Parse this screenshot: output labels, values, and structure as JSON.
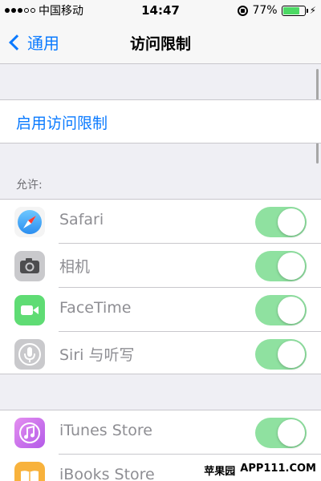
{
  "status_bar": {
    "carrier": "中国移动",
    "time": "14:47",
    "battery_percent": "77%",
    "battery_level": 0.77
  },
  "nav": {
    "back_label": "通用",
    "title": "访问限制"
  },
  "enable_restrictions": "启用访问限制",
  "allow_header": "允许:",
  "allow_items": [
    {
      "label": "Safari",
      "icon": "safari-icon",
      "on": true
    },
    {
      "label": "相机",
      "icon": "camera-icon",
      "on": true
    },
    {
      "label": "FaceTime",
      "icon": "facetime-icon",
      "on": true
    },
    {
      "label": "Siri 与听写",
      "icon": "siri-icon",
      "on": true
    }
  ],
  "store_items": [
    {
      "label": "iTunes Store",
      "icon": "itunes-icon",
      "on": true
    },
    {
      "label": "iBooks Store",
      "icon": "ibooks-icon",
      "on": true
    }
  ],
  "watermark": {
    "brand": "苹果园",
    "site": "APP111.COM"
  },
  "colors": {
    "accent": "#0a7aff",
    "toggle_on": "#8fe1a0"
  }
}
